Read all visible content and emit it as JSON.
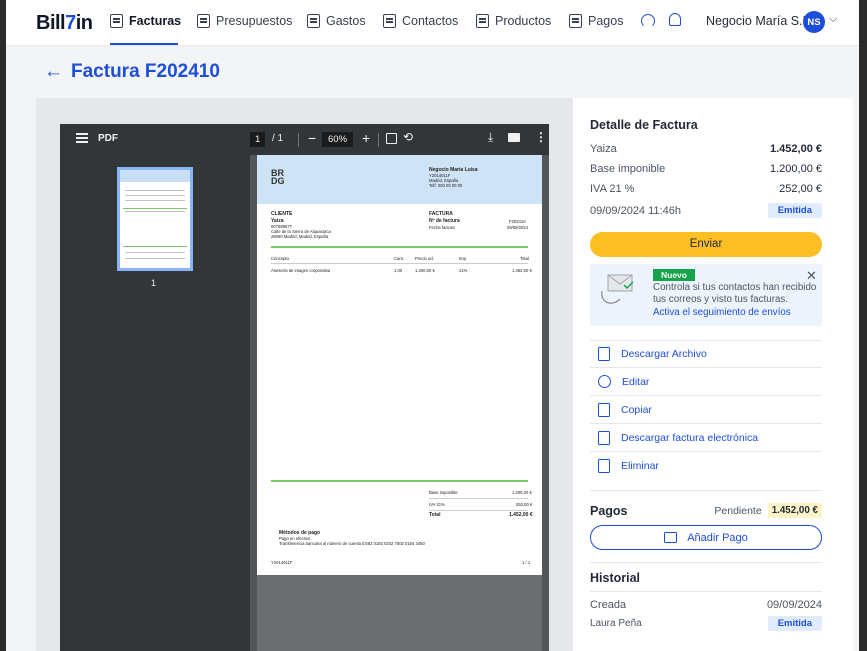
{
  "app": {
    "logo_main": "Bill",
    "logo_arrow": "7",
    "logo_end": "in",
    "nav": [
      {
        "label": "Facturas",
        "icon": "invoice-icon"
      },
      {
        "label": "Presupuestos",
        "icon": "quote-icon"
      },
      {
        "label": "Gastos",
        "icon": "receipt-icon"
      },
      {
        "label": "Contactos",
        "icon": "contacts-icon"
      },
      {
        "label": "Productos",
        "icon": "box-icon"
      },
      {
        "label": "Pagos",
        "icon": "payment-icon"
      }
    ],
    "company": "Negocio María S.L.",
    "avatar": "NS",
    "accent": "#1d4ed8"
  },
  "page": {
    "back_arrow": "←",
    "title": "Factura F202410"
  },
  "pdf": {
    "name": "PDF",
    "current_page": "1",
    "total_pages": "/ 1",
    "zoom": "60%",
    "thumb_number": "1",
    "doc": {
      "logo": "BR\nDG",
      "company_name": "Negocio Maria Luisa",
      "company_id": "Y2014011F",
      "company_city": "Madrid, España",
      "company_phone": "Telf: 000 00 00 00",
      "cliente_label": "CLIENTE",
      "cliente_name": "Yaiza",
      "cliente_id": "00788967T",
      "cliente_addr1": "Calle de la Sierra de Alquasarca",
      "cliente_addr2": "28050 Madrid, Madrid, España",
      "factura_label": "FACTURA",
      "num_label": "Nº de factura",
      "num_value": "F202410",
      "fecha_label": "Fecha factura",
      "fecha_value": "09/09/2024",
      "col_concepto": "Concepto",
      "col_cant": "Cant.",
      "col_precio": "Precio ud.",
      "col_imp": "Imp.",
      "col_total": "Total",
      "line_concepto": "Asesoría de imagen corporativa",
      "line_cant": "1,00",
      "line_precio": "1.200,00 €",
      "line_imp": "21%",
      "line_total": "1.452,00 €",
      "base_label": "Base imponible",
      "base_value": "1.200,00 €",
      "iva_label": "IVA 21%",
      "iva_value": "252,00 €",
      "total_label": "Total",
      "total_value": "1.452,00 €",
      "metodos_title": "Métodos de pago",
      "metodos_1": "Pago en efectivo",
      "metodos_2": "Transferencia bancaria al número de cuenta ES83 0182 0342 7502 0164 3450",
      "footer_id": "Y2014011F",
      "footer_page": "1 / 1"
    }
  },
  "detail": {
    "title": "Detalle de Factura",
    "client": "Yaiza",
    "total": "1.452,00 €",
    "base_label": "Base imponible",
    "base_value": "1.200,00 €",
    "iva_label": "IVA 21 %",
    "iva_value": "252,00 €",
    "datetime": "09/09/2024 11:46h",
    "status": "Emitida",
    "send_label": "Enviar",
    "promo_badge": "Nuevo",
    "promo_text": "Controla si tus contactos han recibido tus correos y visto tus facturas.",
    "promo_link": "Activa el seguimiento de envíos",
    "promo_close": "✕"
  },
  "actions": [
    {
      "label": "Descargar Archivo",
      "icon": "pdf-file-icon"
    },
    {
      "label": "Editar",
      "icon": "edit-icon"
    },
    {
      "label": "Copiar",
      "icon": "copy-icon"
    },
    {
      "label": "Descargar factura electrónica",
      "icon": "e-invoice-icon"
    },
    {
      "label": "Eliminar",
      "icon": "trash-icon"
    }
  ],
  "pagos": {
    "title": "Pagos",
    "status": "Pendiente",
    "amount": "1.452,00 €",
    "add_label": "Añadir Pago"
  },
  "historial": {
    "title": "Historial",
    "event": "Creada",
    "date": "09/09/2024",
    "user": "Laura Peña",
    "status": "Emitida"
  }
}
